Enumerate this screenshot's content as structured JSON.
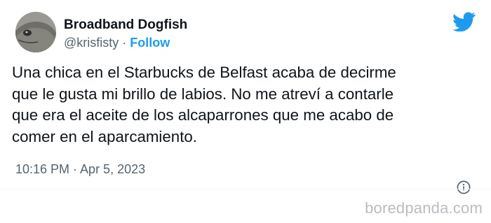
{
  "tweet": {
    "author": {
      "display_name": "Broadband Dogfish",
      "handle": "@krisfisty",
      "separator": " · ",
      "follow_label": "Follow",
      "avatar_icon": "dogfish-avatar"
    },
    "text": "Una chica en el Starbucks de Belfast acaba de decirme\nque le gusta mi brillo de labios. No me atreví a contarle\nque era el aceite de los alcaparrones que me acabo de\ncomer en el aparcamiento.",
    "timestamp": "10:16 PM · Apr 5, 2023",
    "icons": {
      "platform": "twitter-bird-icon",
      "info": "info-icon"
    }
  },
  "watermark": "boredpanda.com",
  "colors": {
    "link_blue": "#1d9bf0",
    "secondary_gray": "#536471",
    "text_black": "#0f1419",
    "watermark_gray": "#b9bcc0"
  }
}
